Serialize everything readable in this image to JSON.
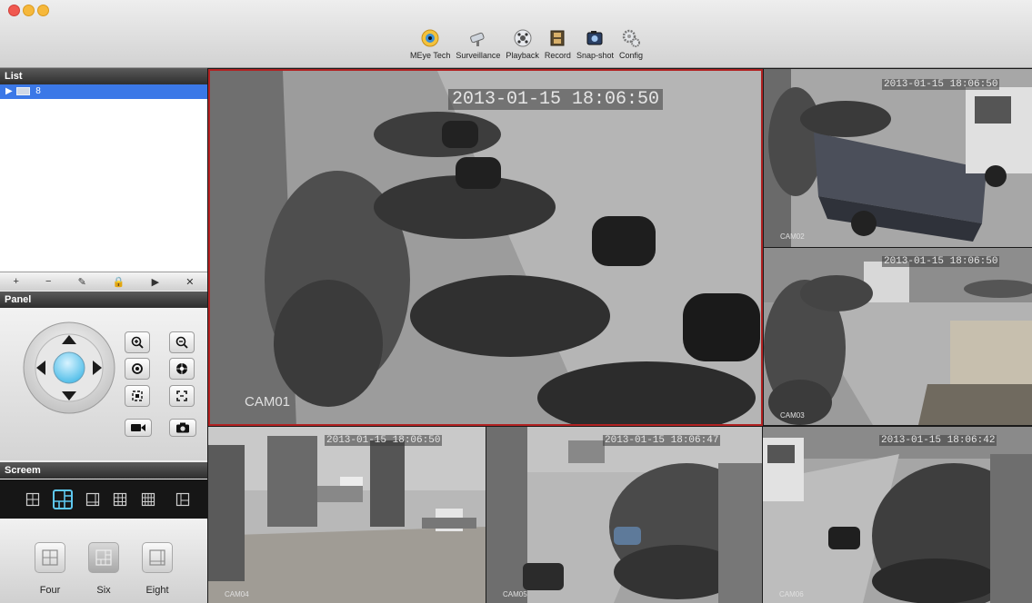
{
  "toolbar": {
    "items": [
      {
        "label": "MEye Tech",
        "icon": "eye-icon"
      },
      {
        "label": "Surveillance",
        "icon": "camera-icon"
      },
      {
        "label": "Playback",
        "icon": "playback-icon"
      },
      {
        "label": "Record",
        "icon": "film-icon"
      },
      {
        "label": "Snap-shot",
        "icon": "snapshot-icon"
      },
      {
        "label": "Config",
        "icon": "gear-icon"
      }
    ]
  },
  "list": {
    "title": "List",
    "items": [
      {
        "label": "8",
        "icon": "dvr-icon"
      }
    ]
  },
  "list_tools": [
    "+",
    "−",
    "✎",
    "🔒",
    "▶",
    "✕"
  ],
  "panel": {
    "title": "Panel"
  },
  "screen": {
    "title": "Screem"
  },
  "modes": [
    {
      "label": "Four",
      "selected": false
    },
    {
      "label": "Six",
      "selected": true
    },
    {
      "label": "Eight",
      "selected": false
    }
  ],
  "cameras": [
    {
      "name": "CAM01",
      "timestamp": "2013-01-15  18:06:50"
    },
    {
      "name": "CAM02",
      "timestamp": "2013-01-15  18:06:50"
    },
    {
      "name": "CAM03",
      "timestamp": "2013-01-15  18:06:50"
    },
    {
      "name": "CAM04",
      "timestamp": "2013-01-15  18:06:50"
    },
    {
      "name": "CAM05",
      "timestamp": "2013-01-15  18:06:47"
    },
    {
      "name": "CAM06",
      "timestamp": "2013-01-15  18:06:42"
    }
  ],
  "colors": {
    "selection": "#3b78e7",
    "active_border": "#b22222",
    "ptz_accent": "#5ec8f0"
  }
}
